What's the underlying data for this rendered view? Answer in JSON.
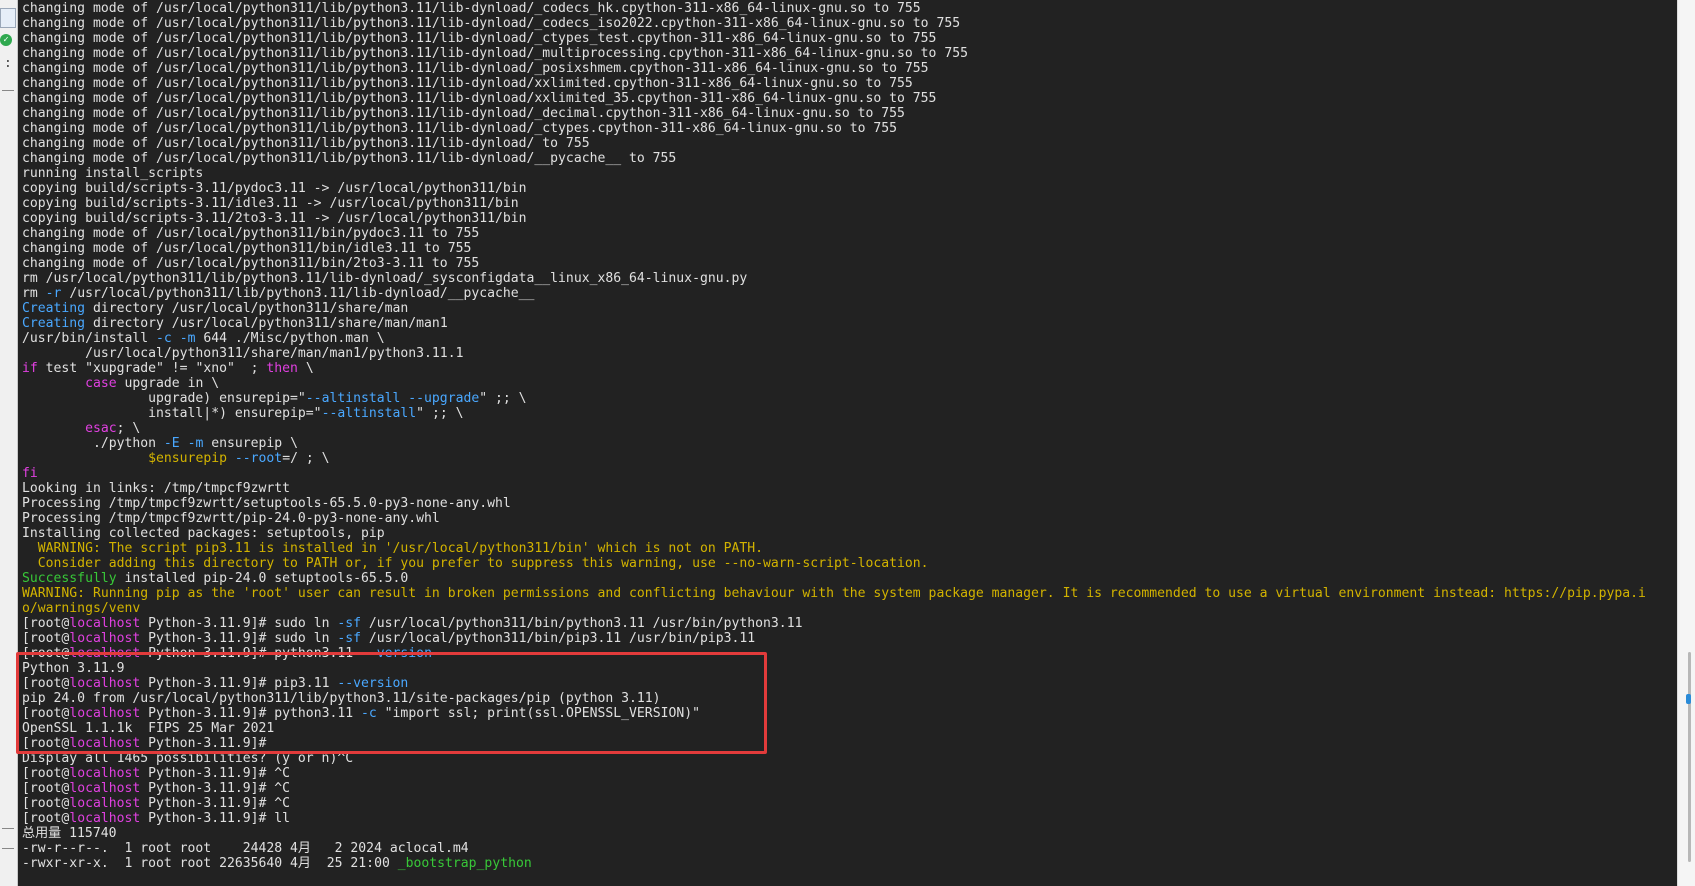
{
  "terminal": {
    "lines": [
      [
        {
          "t": "changing mode of /usr/local/python311/lib/python3.11/lib-dynload/_codecs_hk.cpython-311-x86_64-linux-gnu.so to 755",
          "c": "def"
        }
      ],
      [
        {
          "t": "changing mode of /usr/local/python311/lib/python3.11/lib-dynload/_codecs_iso2022.cpython-311-x86_64-linux-gnu.so to 755",
          "c": "def"
        }
      ],
      [
        {
          "t": "changing mode of /usr/local/python311/lib/python3.11/lib-dynload/_ctypes_test.cpython-311-x86_64-linux-gnu.so to 755",
          "c": "def"
        }
      ],
      [
        {
          "t": "changing mode of /usr/local/python311/lib/python3.11/lib-dynload/_multiprocessing.cpython-311-x86_64-linux-gnu.so to 755",
          "c": "def"
        }
      ],
      [
        {
          "t": "changing mode of /usr/local/python311/lib/python3.11/lib-dynload/_posixshmem.cpython-311-x86_64-linux-gnu.so to 755",
          "c": "def"
        }
      ],
      [
        {
          "t": "changing mode of /usr/local/python311/lib/python3.11/lib-dynload/xxlimited.cpython-311-x86_64-linux-gnu.so to 755",
          "c": "def"
        }
      ],
      [
        {
          "t": "changing mode of /usr/local/python311/lib/python3.11/lib-dynload/xxlimited_35.cpython-311-x86_64-linux-gnu.so to 755",
          "c": "def"
        }
      ],
      [
        {
          "t": "changing mode of /usr/local/python311/lib/python3.11/lib-dynload/_decimal.cpython-311-x86_64-linux-gnu.so to 755",
          "c": "def"
        }
      ],
      [
        {
          "t": "changing mode of /usr/local/python311/lib/python3.11/lib-dynload/_ctypes.cpython-311-x86_64-linux-gnu.so to 755",
          "c": "def"
        }
      ],
      [
        {
          "t": "changing mode of /usr/local/python311/lib/python3.11/lib-dynload/ to 755",
          "c": "def"
        }
      ],
      [
        {
          "t": "changing mode of /usr/local/python311/lib/python3.11/lib-dynload/__pycache__ to 755",
          "c": "def"
        }
      ],
      [
        {
          "t": "running install_scripts",
          "c": "def"
        }
      ],
      [
        {
          "t": "copying build/scripts-3.11/pydoc3.11 -> /usr/local/python311/bin",
          "c": "def"
        }
      ],
      [
        {
          "t": "copying build/scripts-3.11/idle3.11 -> /usr/local/python311/bin",
          "c": "def"
        }
      ],
      [
        {
          "t": "copying build/scripts-3.11/2to3-3.11 -> /usr/local/python311/bin",
          "c": "def"
        }
      ],
      [
        {
          "t": "changing mode of /usr/local/python311/bin/pydoc3.11 to 755",
          "c": "def"
        }
      ],
      [
        {
          "t": "changing mode of /usr/local/python311/bin/idle3.11 to 755",
          "c": "def"
        }
      ],
      [
        {
          "t": "changing mode of /usr/local/python311/bin/2to3-3.11 to 755",
          "c": "def"
        }
      ],
      [
        {
          "t": "rm /usr/local/python311/lib/python3.11/lib-dynload/_sysconfigdata__linux_x86_64-linux-gnu.py",
          "c": "def"
        }
      ],
      [
        {
          "t": "rm ",
          "c": "def"
        },
        {
          "t": "-r",
          "c": "blue"
        },
        {
          "t": " /usr/local/python311/lib/python3.11/lib-dynload/__pycache__",
          "c": "def"
        }
      ],
      [
        {
          "t": "Creating",
          "c": "blue"
        },
        {
          "t": " directory /usr/local/python311/share/man",
          "c": "def"
        }
      ],
      [
        {
          "t": "Creating",
          "c": "blue"
        },
        {
          "t": " directory /usr/local/python311/share/man/man1",
          "c": "def"
        }
      ],
      [
        {
          "t": "/usr/bin/install ",
          "c": "def"
        },
        {
          "t": "-c",
          "c": "blue"
        },
        {
          "t": " ",
          "c": "def"
        },
        {
          "t": "-m",
          "c": "blue"
        },
        {
          "t": " 644 ./Misc/python.man \\",
          "c": "def"
        }
      ],
      [
        {
          "t": "        /usr/local/python311/share/man/man1/python3.11.1",
          "c": "def"
        }
      ],
      [
        {
          "t": "if",
          "c": "mag"
        },
        {
          "t": " test \"xupgrade\" != \"xno\"  ; ",
          "c": "def"
        },
        {
          "t": "then",
          "c": "mag"
        },
        {
          "t": " \\",
          "c": "def"
        }
      ],
      [
        {
          "t": "        ",
          "c": "def"
        },
        {
          "t": "case",
          "c": "mag"
        },
        {
          "t": " upgrade in \\",
          "c": "def"
        }
      ],
      [
        {
          "t": "                upgrade) ensurepip=\"",
          "c": "def"
        },
        {
          "t": "--altinstall --upgrade",
          "c": "blue"
        },
        {
          "t": "\" ;; \\",
          "c": "def"
        }
      ],
      [
        {
          "t": "                install|*) ensurepip=\"",
          "c": "def"
        },
        {
          "t": "--altinstall",
          "c": "blue"
        },
        {
          "t": "\" ;; \\",
          "c": "def"
        }
      ],
      [
        {
          "t": "        ",
          "c": "def"
        },
        {
          "t": "esac",
          "c": "mag"
        },
        {
          "t": "; \\",
          "c": "def"
        }
      ],
      [
        {
          "t": "         ./python ",
          "c": "def"
        },
        {
          "t": "-E",
          "c": "blue"
        },
        {
          "t": " ",
          "c": "def"
        },
        {
          "t": "-m",
          "c": "blue"
        },
        {
          "t": " ensurepip \\",
          "c": "def"
        }
      ],
      [
        {
          "t": "                ",
          "c": "def"
        },
        {
          "t": "$ensurepip",
          "c": "yel"
        },
        {
          "t": " ",
          "c": "def"
        },
        {
          "t": "--root",
          "c": "blue"
        },
        {
          "t": "=/ ; \\",
          "c": "def"
        }
      ],
      [
        {
          "t": "fi",
          "c": "mag"
        }
      ],
      [
        {
          "t": "Looking in links: /tmp/tmpcf9zwrtt",
          "c": "def"
        }
      ],
      [
        {
          "t": "Processing /tmp/tmpcf9zwrtt/setuptools-65.5.0-py3-none-any.whl",
          "c": "def"
        }
      ],
      [
        {
          "t": "Processing /tmp/tmpcf9zwrtt/pip-24.0-py3-none-any.whl",
          "c": "def"
        }
      ],
      [
        {
          "t": "Installing collected packages: setuptools, pip",
          "c": "def"
        }
      ],
      [
        {
          "t": "  WARNING: The script pip3.11 is installed in '/usr/local/python311/bin' which is not on PATH.",
          "c": "yel"
        }
      ],
      [
        {
          "t": "  Consider adding this directory to PATH or, if you prefer to suppress this warning, use --no-warn-script-location.",
          "c": "yel"
        }
      ],
      [
        {
          "t": "Successfully",
          "c": "grn"
        },
        {
          "t": " installed pip-24.0 setuptools-65.5.0",
          "c": "def"
        }
      ],
      [
        {
          "t": "WARNING: Running pip as the 'root' user can result in broken permissions and conflicting behaviour with the system package manager. It is recommended to use a virtual environment instead: https://pip.pypa.i",
          "c": "yel"
        }
      ],
      [
        {
          "t": "o/warnings/venv",
          "c": "yel"
        }
      ],
      [
        {
          "t": "[root@",
          "c": "def"
        },
        {
          "t": "localhost",
          "c": "mag"
        },
        {
          "t": " Python-3.11.9]# sudo ln ",
          "c": "def"
        },
        {
          "t": "-sf",
          "c": "blue"
        },
        {
          "t": " /usr/local/python311/bin/python3.11 /usr/bin/python3.11",
          "c": "def"
        }
      ],
      [
        {
          "t": "[root@",
          "c": "def"
        },
        {
          "t": "localhost",
          "c": "mag"
        },
        {
          "t": " Python-3.11.9]# sudo ln ",
          "c": "def"
        },
        {
          "t": "-sf",
          "c": "blue"
        },
        {
          "t": " /usr/local/python311/bin/pip3.11 /usr/bin/pip3.11",
          "c": "def"
        }
      ],
      [
        {
          "t": "[root@",
          "c": "def"
        },
        {
          "t": "localhost",
          "c": "mag"
        },
        {
          "t": " Python-3.11.9]# python3.11 ",
          "c": "def"
        },
        {
          "t": "--version",
          "c": "blue"
        }
      ],
      [
        {
          "t": "Python 3.11.9",
          "c": "def"
        }
      ],
      [
        {
          "t": "[root@",
          "c": "def"
        },
        {
          "t": "localhost",
          "c": "mag"
        },
        {
          "t": " Python-3.11.9]# pip3.11 ",
          "c": "def"
        },
        {
          "t": "--version",
          "c": "blue"
        }
      ],
      [
        {
          "t": "pip 24.0 from /usr/local/python311/lib/python3.11/site-packages/pip (python 3.11)",
          "c": "def"
        }
      ],
      [
        {
          "t": "[root@",
          "c": "def"
        },
        {
          "t": "localhost",
          "c": "mag"
        },
        {
          "t": " Python-3.11.9]# python3.11 ",
          "c": "def"
        },
        {
          "t": "-c",
          "c": "blue"
        },
        {
          "t": " \"import ssl; print(ssl.OPENSSL_VERSION)\"",
          "c": "def"
        }
      ],
      [
        {
          "t": "OpenSSL 1.1.1k  FIPS 25 Mar 2021",
          "c": "def"
        }
      ],
      [
        {
          "t": "[root@",
          "c": "def"
        },
        {
          "t": "localhost",
          "c": "mag"
        },
        {
          "t": " Python-3.11.9]#",
          "c": "def"
        }
      ],
      [
        {
          "t": "Display all 1465 possibilities? (y or n)^C",
          "c": "def"
        }
      ],
      [
        {
          "t": "[root@",
          "c": "def"
        },
        {
          "t": "localhost",
          "c": "mag"
        },
        {
          "t": " Python-3.11.9]# ^C",
          "c": "def"
        }
      ],
      [
        {
          "t": "[root@",
          "c": "def"
        },
        {
          "t": "localhost",
          "c": "mag"
        },
        {
          "t": " Python-3.11.9]# ^C",
          "c": "def"
        }
      ],
      [
        {
          "t": "[root@",
          "c": "def"
        },
        {
          "t": "localhost",
          "c": "mag"
        },
        {
          "t": " Python-3.11.9]# ^C",
          "c": "def"
        }
      ],
      [
        {
          "t": "[root@",
          "c": "def"
        },
        {
          "t": "localhost",
          "c": "mag"
        },
        {
          "t": " Python-3.11.9]# ll",
          "c": "def"
        }
      ],
      [
        {
          "t": "总用量 115740",
          "c": "def"
        }
      ],
      [
        {
          "t": "-rw-r--r--.  1 root root    24428 4月   2 2024 aclocal.m4",
          "c": "def"
        }
      ],
      [
        {
          "t": "-rwxr-xr-x.  1 root root 22635640 4月  25 21:00 ",
          "c": "def"
        },
        {
          "t": "_bootstrap_python",
          "c": "grn"
        }
      ]
    ]
  },
  "colors": {
    "background": "#222222",
    "default_text": "#e0e0e0",
    "blue": "#4aa8ff",
    "magenta": "#e040e0",
    "yellow": "#d2b300",
    "green": "#38c838",
    "highlight_border": "#e23b3b"
  },
  "icons": {
    "left_strip": [
      "window-icon",
      "check-circle-icon"
    ]
  }
}
